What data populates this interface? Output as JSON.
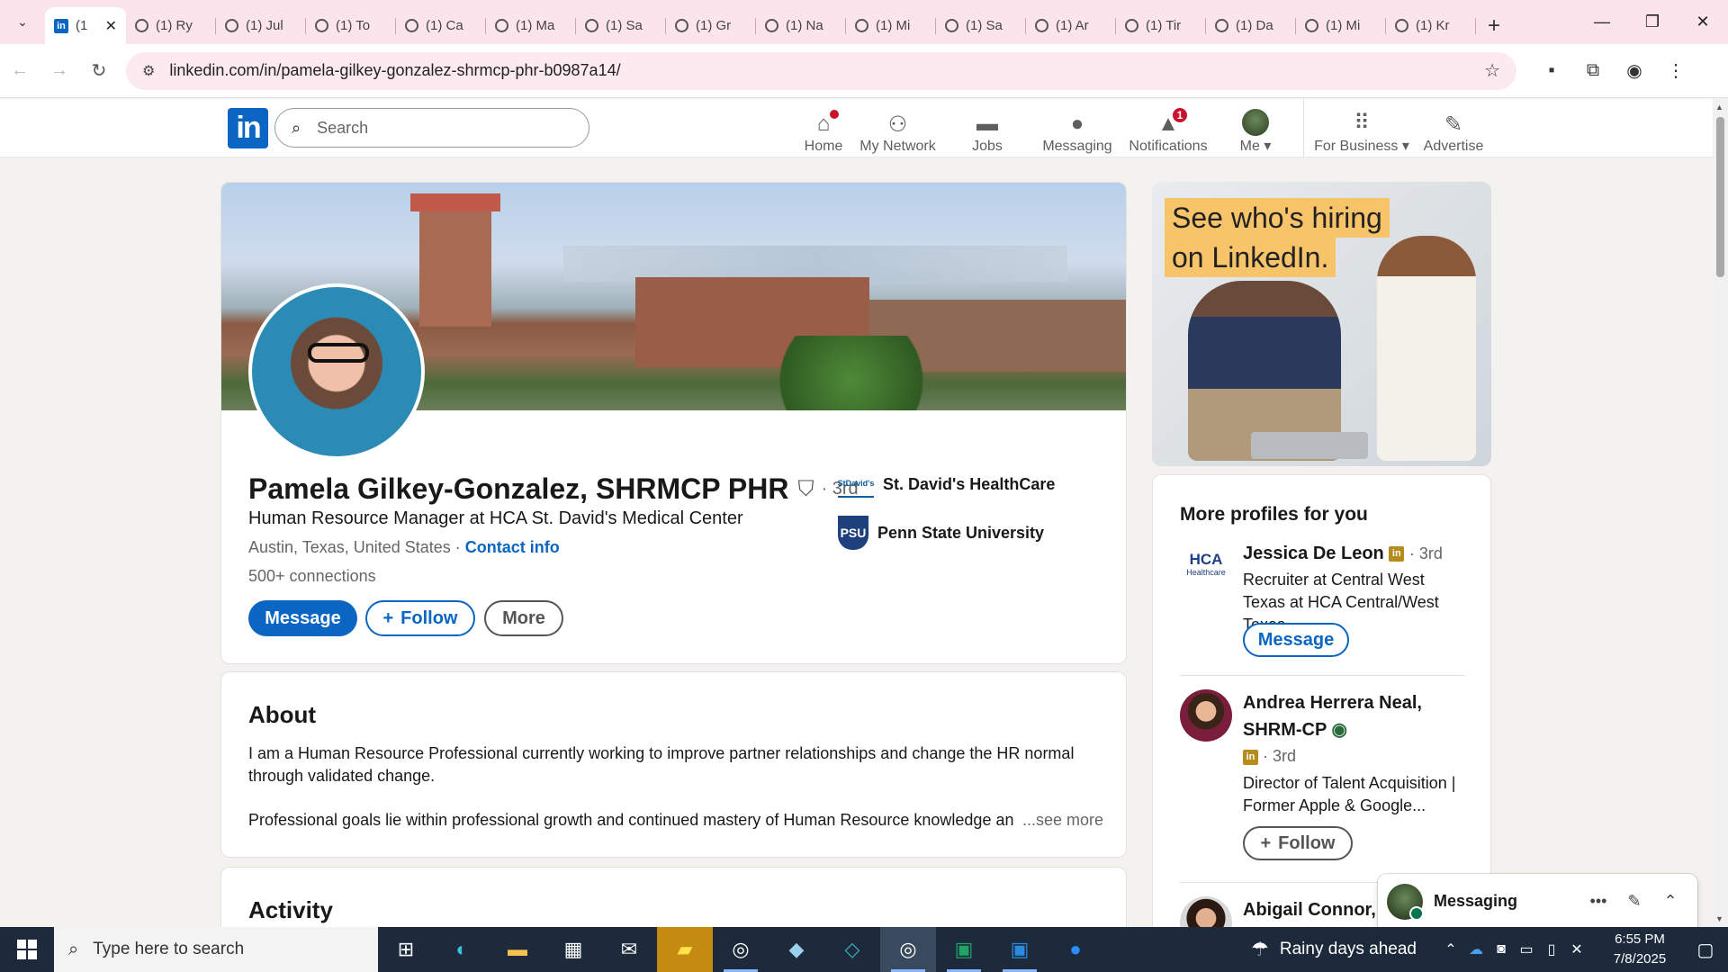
{
  "browser": {
    "tabs": [
      {
        "label": "(1",
        "favicon": "linkedin-icon",
        "active": true
      },
      {
        "label": "(1) Ry"
      },
      {
        "label": "(1) Jul"
      },
      {
        "label": "(1) To"
      },
      {
        "label": "(1) Ca"
      },
      {
        "label": "(1) Ma"
      },
      {
        "label": "(1) Sa"
      },
      {
        "label": "(1) Gr"
      },
      {
        "label": "(1) Na"
      },
      {
        "label": "(1) Mi"
      },
      {
        "label": "(1) Sa"
      },
      {
        "label": "(1) Ar"
      },
      {
        "label": "(1) Tir"
      },
      {
        "label": "(1) Da"
      },
      {
        "label": "(1) Mi"
      },
      {
        "label": "(1) Kr"
      }
    ],
    "url": "linkedin.com/in/pamela-gilkey-gonzalez-shrmcp-phr-b0987a14/"
  },
  "linkedin_nav": {
    "logo": "in",
    "search_placeholder": "Search",
    "items": [
      {
        "label": "Home",
        "icon": "home-icon",
        "badge": "dot"
      },
      {
        "label": "My Network",
        "icon": "network-icon"
      },
      {
        "label": "Jobs",
        "icon": "briefcase-icon"
      },
      {
        "label": "Messaging",
        "icon": "chat-icon"
      },
      {
        "label": "Notifications",
        "icon": "bell-icon",
        "badge": "1"
      },
      {
        "label": "Me",
        "icon": "avatar"
      },
      {
        "label": "For Business",
        "icon": "grid-icon"
      },
      {
        "label": "Advertise",
        "icon": "advertise-icon"
      }
    ]
  },
  "profile": {
    "name": "Pamela Gilkey-Gonzalez, SHRMCP PHR",
    "degree": "· 3rd",
    "headline": "Human Resource Manager at HCA St. David's Medical Center",
    "location": "Austin, Texas, United States",
    "location_sep": " · ",
    "contact_info": "Contact info",
    "connections": "500+ connections",
    "buttons": {
      "message": "Message",
      "follow": "Follow",
      "more": "More"
    },
    "orgs": [
      {
        "name": "St. David's HealthCare",
        "logo_text": "StDavid's"
      },
      {
        "name": "Penn State University",
        "logo_text": "PSU"
      }
    ]
  },
  "about": {
    "title": "About",
    "p1": "I am a Human Resource Professional currently working to improve partner relationships and change the HR normal through validated change.",
    "p2": "Professional goals lie within professional growth and continued mastery of Human Resource knowledge and co",
    "see_more": "...see more"
  },
  "activity": {
    "title": "Activity"
  },
  "ad": {
    "line1": "See who's hiring",
    "line2": "on LinkedIn."
  },
  "more_profiles": {
    "title": "More profiles for you",
    "people": [
      {
        "name": "Jessica De Leon",
        "degree": "· 3rd",
        "headline": "Recruiter at Central West Texas at HCA Central/West Texas",
        "button": "Message",
        "logo_text": "HCA",
        "logo_sub": "Healthcare"
      },
      {
        "name": "Andrea Herrera Neal, SHRM-CP",
        "degree": "· 3rd",
        "headline": "Director of Talent Acquisition | Former Apple & Google...",
        "button": "Follow"
      },
      {
        "name": "Abigail Connor, M"
      }
    ]
  },
  "messaging_dock": {
    "label": "Messaging"
  },
  "taskbar": {
    "search_placeholder": "Type here to search",
    "weather": "Rainy days ahead",
    "time": "6:55 PM",
    "date": "7/8/2025"
  },
  "colors": {
    "linkedin_blue": "#0a66c2",
    "badge_red": "#cb112d",
    "tab_strip": "#fce4ec"
  }
}
